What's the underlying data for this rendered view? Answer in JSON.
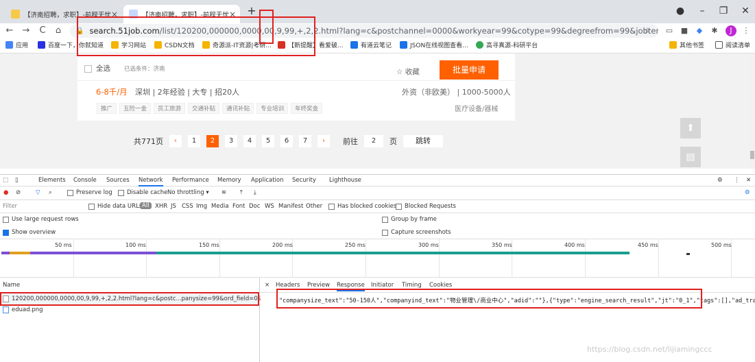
{
  "browser": {
    "tabs": [
      {
        "title": "【济南招聘，求职】-前程无忧",
        "close": "×"
      },
      {
        "title": "【济南招聘，求职】-前程无忧",
        "close": "×"
      }
    ],
    "new_tab": "+",
    "window_controls": {
      "minimize": "–",
      "maximize": "❐",
      "close": "✕"
    },
    "nav": {
      "back": "←",
      "forward": "→",
      "reload": "C",
      "home": "⌂"
    },
    "url_host": "search.51job.com",
    "url_rest": "/list/120200,000000,0000,00,9,99,+,2,2.html?lang=c&postchannel=0000&workyear=99&cotype=99&degreefrom=99&jobterm=99&companysize=...",
    "star": "☆",
    "profile_initial": "J",
    "menu": "⋮"
  },
  "bookmarks": {
    "items": [
      {
        "label": "应用",
        "color": "#4285f4"
      },
      {
        "label": "百度一下，你就知道",
        "color": "#2932e1"
      },
      {
        "label": "学习网站",
        "color": "#f4b400"
      },
      {
        "label": "CSDN文档",
        "color": "#f4b400"
      },
      {
        "label": "奇源派-IT资源|考研...",
        "color": "#f4b400"
      },
      {
        "label": "【新提醒】看爱破...",
        "color": "#d93025"
      },
      {
        "label": "有道云笔记",
        "color": "#1a73e8"
      },
      {
        "label": "JSON在线视图查看...",
        "color": "#1a73e8"
      },
      {
        "label": "高寻真源-科研平台",
        "color": "#34a853"
      }
    ],
    "other": "其他书签",
    "reading": "阅读清单"
  },
  "page": {
    "select_all": "全选",
    "selected_filter": "已选条件：济南",
    "favorite": "☆ 收藏",
    "apply": "批量申请",
    "salary": "6-8千/月",
    "job_meta": "深圳 | 2年经验 | 大专 | 招20人",
    "company_type": "外资（非欧美） | 1000-5000人",
    "industry": "医疗设备/器械",
    "tags": [
      "推广",
      "五险一金",
      "员工旅游",
      "交通补贴",
      "通讯补贴",
      "专业培训",
      "年终奖金"
    ],
    "total_pages": "共771页",
    "pages": [
      "1",
      "2",
      "3",
      "4",
      "5",
      "6",
      "7"
    ],
    "current_page": "2",
    "prev": "‹",
    "next": "›",
    "goto_label": "前往",
    "goto_value": "2",
    "goto_unit": "页",
    "jump": "跳转",
    "side_top": "⬆",
    "side_feedback": "▤"
  },
  "devtools": {
    "tabs": [
      "Elements",
      "Console",
      "Sources",
      "Network",
      "Performance",
      "Memory",
      "Application",
      "Security",
      "Lighthouse"
    ],
    "selected_tab": "Network",
    "preserve_log": "Preserve log",
    "disable_cache": "Disable cache",
    "throttling": "No throttling",
    "filter_placeholder": "Filter",
    "hide_data_urls": "Hide data URLs",
    "types": [
      "All",
      "XHR",
      "JS",
      "CSS",
      "Img",
      "Media",
      "Font",
      "Doc",
      "WS",
      "Manifest",
      "Other"
    ],
    "has_blocked_cookies": "Has blocked cookies",
    "blocked_requests": "Blocked Requests",
    "use_large_rows": "Use large request rows",
    "group_by_frame": "Group by frame",
    "show_overview": "Show overview",
    "capture_screenshots": "Capture screenshots",
    "timeline_ticks": [
      "50 ms",
      "100 ms",
      "150 ms",
      "200 ms",
      "250 ms",
      "300 ms",
      "350 ms",
      "400 ms",
      "450 ms",
      "500 ms"
    ],
    "name_header": "Name",
    "requests": [
      "120200,000000,0000,00,9,99,+,2,2.html?lang=c&postc...panysize=99&ord_field=0&dibiaoid...",
      "eduad.png"
    ],
    "response_tabs": [
      "Headers",
      "Preview",
      "Response",
      "Initiator",
      "Timing",
      "Cookies"
    ],
    "selected_response_tab": "Response",
    "close_x": "×",
    "response_text": "\"companysize_text\":\"50-150人\",\"companyind_text\":\"物业管理\\/商业中心\",\"adid\":\"\"},{\"type\":\"engine_search_result\",\"jt\":\"0_1\",\"tags\":[],\"ad_track\":\"\","
  },
  "watermark": "https://blog.csdn.net/lijiamingccc"
}
